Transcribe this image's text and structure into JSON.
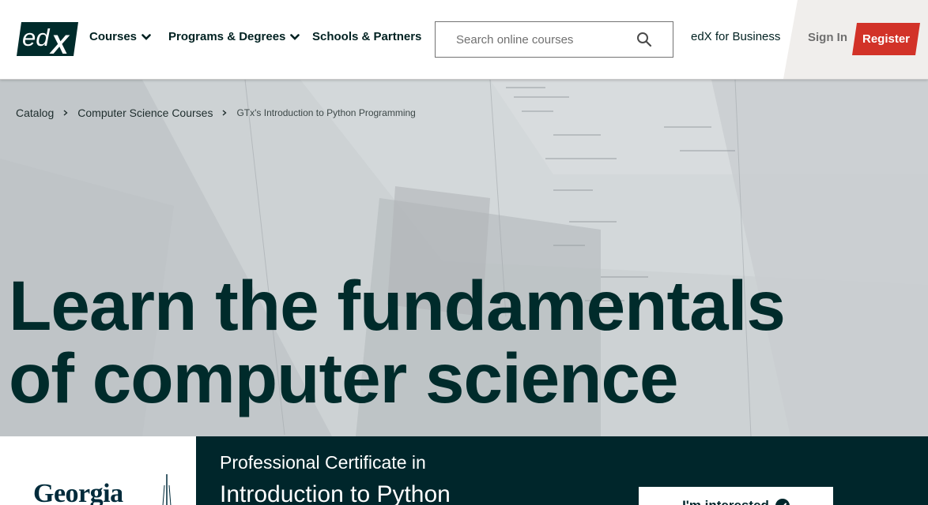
{
  "brand": {
    "logo_text_ed": "ed",
    "logo_text_x": "X",
    "colors": {
      "primary": "#002b2b",
      "accent": "#d23228",
      "dark_panel": "#00262b",
      "hero_bg": "#c3c8cb"
    }
  },
  "nav": {
    "courses": "Courses",
    "programs": "Programs & Degrees",
    "schools": "Schools & Partners",
    "search_placeholder": "Search online courses",
    "business": "edX for Business",
    "signin": "Sign In",
    "register": "Register",
    "icons": {
      "dropdown": "chevron-down-icon",
      "search": "search-icon"
    }
  },
  "breadcrumb": {
    "items": [
      "Catalog",
      "Computer Science Courses"
    ],
    "current": "GTx's Introduction to Python Programming"
  },
  "hero": {
    "title_line1": "Learn the fundamentals",
    "title_line2": "of computer science"
  },
  "school": {
    "logo_text": "Georgia"
  },
  "program": {
    "type_label": "Professional Certificate in",
    "name": "Introduction to Python",
    "cta_label": "I'm interested",
    "cta_icon": "check-circle-icon"
  }
}
